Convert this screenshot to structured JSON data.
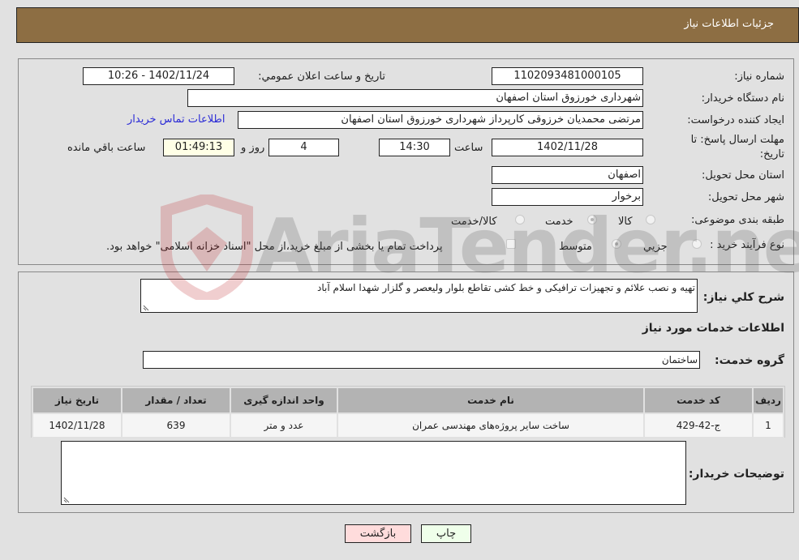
{
  "header": {
    "title": "جزئيات اطلاعات نياز"
  },
  "info": {
    "need_number_label": "شماره نیاز:",
    "need_number": "1102093481000105",
    "announce_label": "تاريخ و ساعت اعلان عمومي:",
    "announce_value": "1402/11/24 - 10:26",
    "buyer_org_label": "نام دستگاه خریدار:",
    "buyer_org": "شهرداری خورزوق استان اصفهان",
    "creator_label": "ایجاد کننده درخواست:",
    "creator": "مرتضی محمدیان خرزوقی کارپرداز شهرداری خورزوق استان اصفهان",
    "contact_link": "اطلاعات تماس خریدار",
    "deadline_label_line1": "مهلت ارسال پاسخ: تا",
    "deadline_label_line2": "تاریخ:",
    "deadline_date": "1402/11/28",
    "time_label": "ساعت",
    "deadline_time": "14:30",
    "days_value": "4",
    "days_label": "روز و",
    "remaining_time": "01:49:13",
    "remaining_label": "ساعت باقي مانده",
    "province_label": "استان محل تحویل:",
    "province": "اصفهان",
    "city_label": "شهر محل تحویل:",
    "city": "برخوار",
    "category_label": "طبقه بندی موضوعی:",
    "category_options": [
      {
        "label": "کالا",
        "checked": false
      },
      {
        "label": "خدمت",
        "checked": true
      },
      {
        "label": "کالا/خدمت",
        "checked": false
      }
    ],
    "process_label": "نوع فرآیند خرید :",
    "process_options": [
      {
        "label": "جزيي",
        "checked": false
      },
      {
        "label": "متوسط",
        "checked": true
      }
    ],
    "treasury_checkbox_label": "پرداخت تمام یا بخشی از مبلغ خرید،از محل \"اسناد خزانه اسلامی\" خواهد بود.",
    "treasury_checked": false
  },
  "details": {
    "description_label": "شرح كلي نياز:",
    "description": "تهيه و نصب علائم و تجهيزات ترافيكی و خط كشی تقاطع بلوار وليعصر و گلزار شهدا اسلام آباد",
    "services_heading": "اطلاعات خدمات مورد نياز",
    "service_group_label": "گروه خدمت:",
    "service_group": "ساختمان",
    "table": {
      "headers": [
        "رديف",
        "كد خدمت",
        "نام خدمت",
        "واحد اندازه گيری",
        "تعداد / مقدار",
        "تاريخ نياز"
      ],
      "rows": [
        [
          "1",
          "ج-42-429",
          "ساخت ساير پروژه‌های مهندسی عمران",
          "عدد و متر",
          "639",
          "1402/11/28"
        ]
      ]
    },
    "buyer_notes_label": "توضيحات خريدار:",
    "buyer_notes": ""
  },
  "buttons": {
    "print": "چاپ",
    "back": "بازگشت"
  },
  "watermark": {
    "text": "AriaTender.neT"
  }
}
